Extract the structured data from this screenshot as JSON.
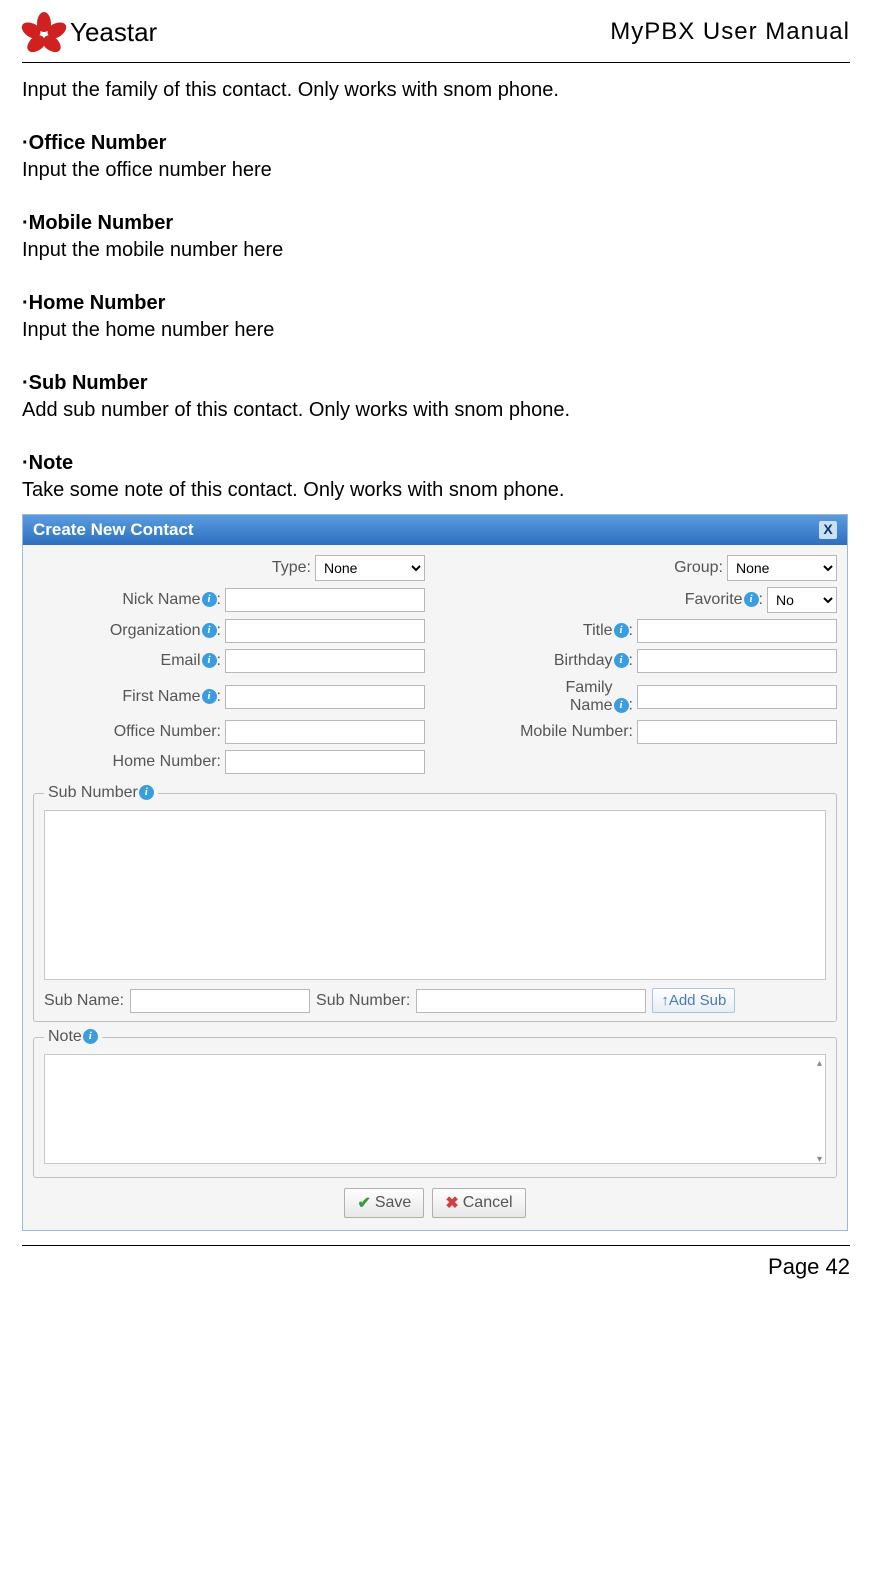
{
  "header": {
    "logo_text": "Yeastar",
    "manual_title": "MyPBX User Manual"
  },
  "content": {
    "intro_line": "Input the family of this contact. Only works with snom phone.",
    "sections": [
      {
        "heading": "·Office Number",
        "text": "Input the office number here"
      },
      {
        "heading": "·Mobile Number",
        "text": "Input the mobile number here"
      },
      {
        "heading": "·Home Number",
        "text": "Input the home number here"
      },
      {
        "heading": "·Sub Number",
        "text": "Add sub number of this contact. Only works with snom phone."
      },
      {
        "heading": "·Note",
        "text": "Take some note of this contact. Only works with snom phone."
      }
    ]
  },
  "dialog": {
    "title": "Create New Contact",
    "fields": {
      "type_label": "Type:",
      "type_value": "None",
      "group_label": "Group:",
      "group_value": "None",
      "nickname_label": "Nick Name",
      "favorite_label": "Favorite",
      "favorite_value": "No",
      "organization_label": "Organization",
      "title_label": "Title",
      "email_label": "Email",
      "birthday_label": "Birthday",
      "firstname_label": "First Name",
      "familyname_label": "Family Name",
      "officenum_label": "Office Number:",
      "mobilenum_label": "Mobile Number:",
      "homenum_label": "Home Number:"
    },
    "subnumber": {
      "legend": "Sub Number",
      "subname_label": "Sub Name:",
      "subnumber_label": "Sub Number:",
      "addsub_label": "↑Add Sub"
    },
    "note": {
      "legend": "Note"
    },
    "buttons": {
      "save": "Save",
      "cancel": "Cancel"
    }
  },
  "footer": {
    "page": "Page 42"
  }
}
